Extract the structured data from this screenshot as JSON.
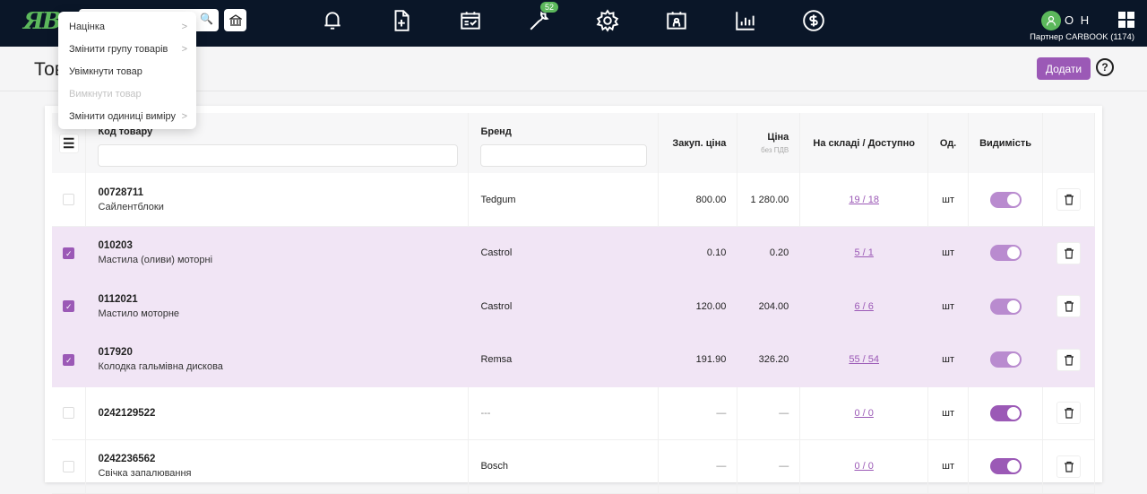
{
  "header": {
    "logo": "ЯB",
    "search_placeholder": "",
    "notifications_badge": "52",
    "user_initials": "O H",
    "partner": "Партнер CARBOOK (1174)",
    "icons": [
      "bell-icon",
      "document-add-icon",
      "calendar-check-icon",
      "wrench-icon",
      "gear-icon",
      "calendar-person-icon",
      "bar-chart-icon",
      "dollar-icon"
    ]
  },
  "page": {
    "title": "Товари",
    "add_label": "Додати",
    "help": "?"
  },
  "dropdown": {
    "items": [
      {
        "label": "Націнка",
        "submenu": true,
        "disabled": false
      },
      {
        "label": "Змінити групу товарів",
        "submenu": true,
        "disabled": false
      },
      {
        "label": "Увімкнути товар",
        "submenu": false,
        "disabled": false
      },
      {
        "label": "Вимкнути товар",
        "submenu": false,
        "disabled": true
      },
      {
        "label": "Змінити одиниці виміру",
        "submenu": true,
        "disabled": false
      }
    ]
  },
  "table": {
    "columns": {
      "code": "Код товару",
      "brand": "Бренд",
      "buy_price": "Закуп. ціна",
      "price": "Ціна",
      "price_sub": "без ПДВ",
      "stock": "На складі / Доступно",
      "unit": "Од.",
      "visibility": "Видимість"
    },
    "filters": {
      "code": "",
      "brand": ""
    },
    "rows": [
      {
        "checked": false,
        "code": "00728711",
        "name": "Сайлентблоки",
        "brand": "Tedgum",
        "buy": "800.00",
        "price": "1 280.00",
        "stock": "19 / 18",
        "unit": "шт",
        "visible": true
      },
      {
        "checked": true,
        "code": "010203",
        "name": "Мастила (оливи) моторні",
        "brand": "Castrol",
        "buy": "0.10",
        "price": "0.20",
        "stock": "5 / 1",
        "unit": "шт",
        "visible": true
      },
      {
        "checked": true,
        "code": "0112021",
        "name": "Мастило моторне",
        "brand": "Castrol",
        "buy": "120.00",
        "price": "204.00",
        "stock": "6 / 6",
        "unit": "шт",
        "visible": true
      },
      {
        "checked": true,
        "code": "017920",
        "name": "Колодка гальмівна дискова",
        "brand": "Remsa",
        "buy": "191.90",
        "price": "326.20",
        "stock": "55 / 54",
        "unit": "шт",
        "visible": true
      },
      {
        "checked": false,
        "code": "0242129522",
        "name": "",
        "brand": "---",
        "buy": "—",
        "price": "—",
        "stock": "0 / 0",
        "unit": "шт",
        "visible": true
      },
      {
        "checked": false,
        "code": "0242236562",
        "name": "Свічка запалювання",
        "brand": "Bosch",
        "buy": "—",
        "price": "—",
        "stock": "0 / 0",
        "unit": "шт",
        "visible": true
      }
    ]
  },
  "colors": {
    "accent": "#9b59b6",
    "topbar": "#0a1628",
    "green": "#5cb85c",
    "selected_row": "#f1e5f5"
  }
}
